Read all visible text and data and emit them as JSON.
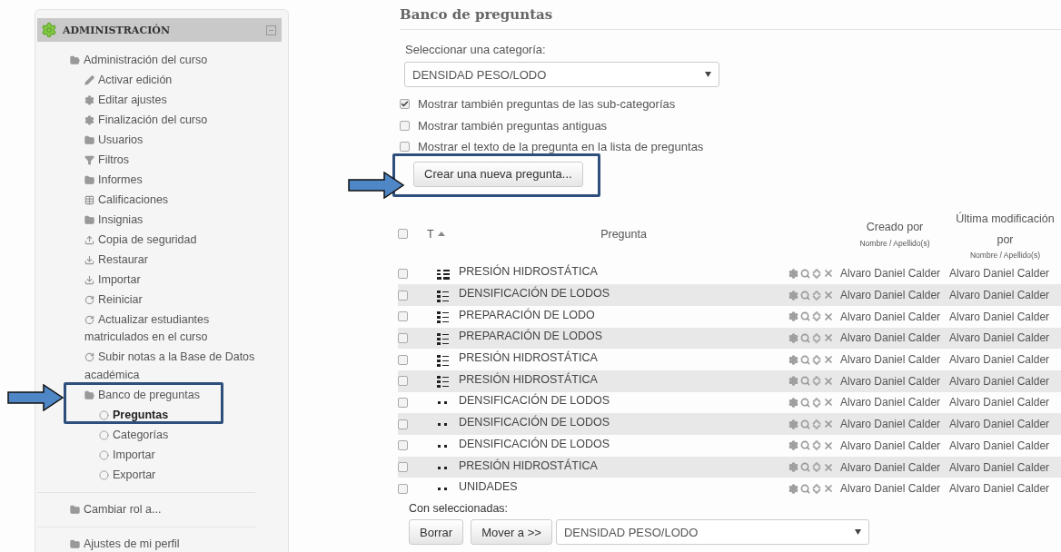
{
  "sidebar": {
    "title": "ADMINISTRACIÓN",
    "items": [
      {
        "label": "Administración del curso",
        "kind": "folder-open",
        "selected": false,
        "children": [
          {
            "label": "Activar edición",
            "kind": "pencil",
            "selected": false
          },
          {
            "label": "Editar ajustes",
            "kind": "gear",
            "selected": false
          },
          {
            "label": "Finalización del curso",
            "kind": "gear",
            "selected": false
          },
          {
            "label": "Usuarios",
            "kind": "folder",
            "selected": false
          },
          {
            "label": "Filtros",
            "kind": "filter",
            "selected": false
          },
          {
            "label": "Informes",
            "kind": "folder",
            "selected": false
          },
          {
            "label": "Calificaciones",
            "kind": "grid",
            "selected": false
          },
          {
            "label": "Insignias",
            "kind": "folder",
            "selected": false
          },
          {
            "label": "Copia de seguridad",
            "kind": "upload",
            "selected": false
          },
          {
            "label": "Restaurar",
            "kind": "download",
            "selected": false
          },
          {
            "label": "Importar",
            "kind": "download",
            "selected": false
          },
          {
            "label": "Reiniciar",
            "kind": "refresh",
            "selected": false
          },
          {
            "label": "Actualizar estudiantes matriculados en el curso",
            "kind": "refresh",
            "selected": false
          },
          {
            "label": "Subir notas a la Base de Datos académica",
            "kind": "refresh",
            "selected": false
          },
          {
            "label": "Banco de preguntas",
            "kind": "folder-open",
            "selected": false,
            "children": [
              {
                "label": "Preguntas",
                "kind": "circle",
                "selected": true
              },
              {
                "label": "Categorías",
                "kind": "circle",
                "selected": false
              },
              {
                "label": "Importar",
                "kind": "circle",
                "selected": false
              },
              {
                "label": "Exportar",
                "kind": "circle",
                "selected": false
              }
            ]
          }
        ]
      },
      {
        "label": "Cambiar rol a...",
        "kind": "folder",
        "selected": false
      },
      {
        "label": "Ajustes de mi perfil",
        "kind": "folder",
        "selected": false
      }
    ]
  },
  "main": {
    "title": "Banco de preguntas",
    "category_label": "Seleccionar una categoría:",
    "category": {
      "value": "DENSIDAD PESO/LODO"
    },
    "options": [
      {
        "label": "Mostrar también preguntas de las sub-categorías",
        "checked": true
      },
      {
        "label": "Mostrar también preguntas antiguas",
        "checked": false
      },
      {
        "label": "Mostrar el texto de la pregunta en la lista de preguntas",
        "checked": false
      }
    ],
    "create_button": "Crear una nueva pregunta...",
    "table": {
      "select_all": false,
      "type_header": {
        "label": "T",
        "sorted_ascending": true
      },
      "question_header": "Pregunta",
      "created_header": {
        "label": "Creado por",
        "sub": "Nombre / Apellido(s)"
      },
      "modified_header": {
        "label": "Última modificación por",
        "sub": "Nombre / Apellido(s)"
      },
      "rows": [
        {
          "checked": false,
          "kind": "matching",
          "name": "PRESIÓN HIDROSTÁTICA",
          "created_by": "Alvaro Daniel Calder",
          "modified_by": "Alvaro Daniel Calder"
        },
        {
          "checked": false,
          "kind": "multichoice",
          "name": "DENSIFICACIÓN DE LODOS",
          "created_by": "Alvaro Daniel Calder",
          "modified_by": "Alvaro Daniel Calder"
        },
        {
          "checked": false,
          "kind": "multichoice",
          "name": "PREPARACIÓN DE LODO",
          "created_by": "Alvaro Daniel Calder",
          "modified_by": "Alvaro Daniel Calder"
        },
        {
          "checked": false,
          "kind": "multichoice",
          "name": "PREPARACIÓN DE LODOS",
          "created_by": "Alvaro Daniel Calder",
          "modified_by": "Alvaro Daniel Calder"
        },
        {
          "checked": false,
          "kind": "multichoice",
          "name": "PRESIÓN HIDROSTÁTICA",
          "created_by": "Alvaro Daniel Calder",
          "modified_by": "Alvaro Daniel Calder"
        },
        {
          "checked": false,
          "kind": "multichoice",
          "name": "PRESIÓN HIDROSTÁTICA",
          "created_by": "Alvaro Daniel Calder",
          "modified_by": "Alvaro Daniel Calder"
        },
        {
          "checked": false,
          "kind": "shortanswer",
          "name": "DENSIFICACIÓN DE LODOS",
          "created_by": "Alvaro Daniel Calder",
          "modified_by": "Alvaro Daniel Calder"
        },
        {
          "checked": false,
          "kind": "shortanswer",
          "name": "DENSIFICACIÓN DE LODOS",
          "created_by": "Alvaro Daniel Calder",
          "modified_by": "Alvaro Daniel Calder"
        },
        {
          "checked": false,
          "kind": "shortanswer",
          "name": "DENSIFICACIÓN DE LODOS",
          "created_by": "Alvaro Daniel Calder",
          "modified_by": "Alvaro Daniel Calder"
        },
        {
          "checked": false,
          "kind": "shortanswer",
          "name": "PRESIÓN HIDROSTÁTICA",
          "created_by": "Alvaro Daniel Calder",
          "modified_by": "Alvaro Daniel Calder"
        },
        {
          "checked": false,
          "kind": "shortanswer",
          "name": "UNIDADES",
          "created_by": "Alvaro Daniel Calder",
          "modified_by": "Alvaro Daniel Calder"
        }
      ]
    },
    "bulk": {
      "label": "Con seleccionadas:",
      "buttons": [
        "Borrar",
        "Mover a >>"
      ],
      "target": {
        "value": "DENSIDAD PESO/LODO"
      }
    }
  }
}
